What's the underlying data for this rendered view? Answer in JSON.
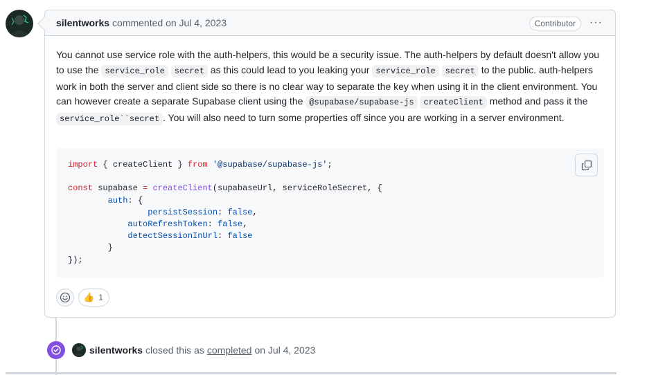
{
  "comment": {
    "author": "silentworks",
    "meta": "commented on Jul 4, 2023",
    "role_badge": "Contributor",
    "menu_glyph": "···",
    "body_parts": [
      "You cannot use service role with the auth-helpers, this would be a security issue. The auth-helpers by default doesn't allow you to use the ",
      "service_role",
      "secret",
      " as this could lead to you leaking your ",
      "service_role",
      "secret",
      " to the public. auth-helpers work in both the server and client side so there is no clear way to separate the key when using it in the client environment. You can however create a separate Supabase client using the ",
      "@supabase/supabase-js",
      "createClient",
      " method and pass it the ",
      "service_role``secret",
      ". You will also need to turn some properties off since you are working in a server environment."
    ],
    "code": {
      "import_kw": "import",
      "import_names": " { createClient } ",
      "from_kw": "from",
      "module": "'@supabase/supabase-js'",
      "semicolon": ";",
      "const_kw": "const",
      "var_name": " supabase ",
      "eq": "=",
      "fn_name": "createClient",
      "args": "(supabaseUrl, serviceRoleSecret, {",
      "auth_key": "auth",
      "open_brace": ": {",
      "persist_key": "persistSession",
      "refresh_key": "autoRefreshToken",
      "detect_key": "detectSessionInUrl",
      "false_val": "false",
      "close_inner": "}",
      "close_outer": "});"
    },
    "reactions": [
      {
        "emoji": "👍",
        "count": "1"
      }
    ]
  },
  "event": {
    "author": "silentworks",
    "text_before": "closed this as",
    "link": "completed",
    "text_after": "on Jul 4, 2023"
  },
  "icons": {
    "copy": "copy-icon",
    "smiley": "smiley-icon",
    "check": "check-circle-icon"
  },
  "colors": {
    "closed_badge": "#8250df",
    "keyword": "#cf222e",
    "string": "#0a3069",
    "function": "#8250df",
    "property": "#0550ae"
  }
}
